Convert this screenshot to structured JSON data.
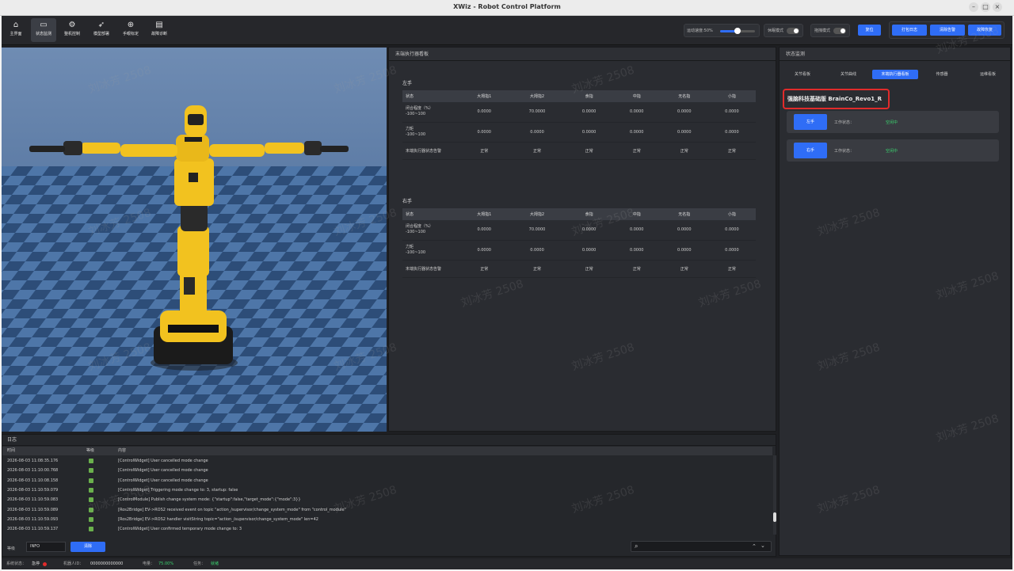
{
  "window": {
    "title": "XWiz - Robot Control Platform"
  },
  "toolbar": {
    "buttons": [
      {
        "label": "主界面",
        "icon": "home-icon"
      },
      {
        "label": "状态监测",
        "icon": "monitor-icon"
      },
      {
        "label": "整机控制",
        "icon": "robot-control-icon"
      },
      {
        "label": "模型部署",
        "icon": "rocket-icon"
      },
      {
        "label": "手眼标定",
        "icon": "calibration-icon"
      },
      {
        "label": "故障诊断",
        "icon": "diagnosis-icon"
      }
    ],
    "speed_label": "运动速度:50%",
    "speed_value": 0.5,
    "mode1_label": "休眠模式",
    "mode2_label": "拖拽模式",
    "reset_label": "复位",
    "action_buttons": [
      "打包日志",
      "清除告警",
      "故障恢复"
    ]
  },
  "effector_panel": {
    "title": "末端执行器看板",
    "columns": [
      "状态",
      "大拇指1",
      "大拇指2",
      "食指",
      "中指",
      "无名指",
      "小指"
    ],
    "left_hand": {
      "title": "左手",
      "rows": [
        {
          "label1": "闭合程度（%）",
          "label2": "-100~100",
          "values": [
            "0.0000",
            "70.0000",
            "0.0000",
            "0.0000",
            "0.0000",
            "0.0000"
          ]
        },
        {
          "label1": "力矩",
          "label2": "-100~100",
          "values": [
            "0.0000",
            "0.0000",
            "0.0000",
            "0.0000",
            "0.0000",
            "0.0000"
          ]
        }
      ],
      "status_row": {
        "label": "末端执行器状态告警",
        "values": [
          "正常",
          "正常",
          "正常",
          "正常",
          "正常",
          "正常"
        ]
      }
    },
    "right_hand": {
      "title": "右手",
      "rows": [
        {
          "label1": "闭合程度（%）",
          "label2": "-100~100",
          "values": [
            "0.0000",
            "70.0000",
            "0.0000",
            "0.0000",
            "0.0000",
            "0.0000"
          ]
        },
        {
          "label1": "力矩",
          "label2": "-100~100",
          "values": [
            "0.0000",
            "0.0000",
            "0.0000",
            "0.0000",
            "0.0000",
            "0.0000"
          ]
        }
      ],
      "status_row": {
        "label": "末端执行器状态告警",
        "values": [
          "正常",
          "正常",
          "正常",
          "正常",
          "正常",
          "正常"
        ]
      }
    }
  },
  "status_panel": {
    "title": "状态监测",
    "tabs": [
      "关节看板",
      "关节曲线",
      "末端执行器看板",
      "传感器",
      "运维看板"
    ],
    "active_tab": 2,
    "board_title": "强脑科技基础版 BrainCo_Revo1_R",
    "cards": [
      {
        "button": "左手",
        "work_label": "工作状态：",
        "work_status": "空闲中"
      },
      {
        "button": "右手",
        "work_label": "工作状态：",
        "work_status": "空闲中"
      }
    ]
  },
  "log_panel": {
    "title": "日志",
    "columns": [
      "时间",
      "等级",
      "内容"
    ],
    "rows": [
      {
        "time": "2026-08-03 11:08:35.176",
        "msg": "[ControlWidget] User cancelled mode change"
      },
      {
        "time": "2026-08-03 11:10:00.768",
        "msg": "[ControlWidget] User cancelled mode change"
      },
      {
        "time": "2026-08-03 11:10:08.158",
        "msg": "[ControlWidget] User cancelled mode change"
      },
      {
        "time": "2026-08-03 11:10:59.079",
        "msg": "[ControlWidget] Triggering mode change to: 3, startup: false"
      },
      {
        "time": "2026-08-03 11:10:59.083",
        "msg": "[ControlModule] Publish change system mode: {\"startup\":false,\"target_mode\":{\"mode\":3}}"
      },
      {
        "time": "2026-08-03 11:10:59.089",
        "msg": "[Ros2Bridge] EV->ROS2 received event on topic \"action_/supervisor/change_system_mode\" from \"control_module\""
      },
      {
        "time": "2026-08-03 11:10:59.093",
        "msg": "[Ros2Bridge] EV->ROS2 handler visitString topic=\"action_/supervisor/change_system_mode\" len=42"
      },
      {
        "time": "2026-08-03 11:10:59.137",
        "msg": "[ControlWidget] User confirmed temporary mode change to: 3"
      }
    ],
    "level_label": "等级",
    "level_value": "INFO",
    "clear_label": "清除",
    "search_placeholder": ""
  },
  "status_bar": {
    "state_label": "系统状态：",
    "state_value": "急停",
    "robot_label": "机器人ID：",
    "robot_value": "0000000000000",
    "battery_label": "电量：",
    "battery_value": "75.00%",
    "task_label": "任务：",
    "task_value": "就绪"
  },
  "watermark": "刘冰芳 2508",
  "colors": {
    "accent": "#2f6df6",
    "highlight_border": "#e12b2b",
    "ok_green": "#3bd16f",
    "robot_yellow": "#f2c21f"
  }
}
